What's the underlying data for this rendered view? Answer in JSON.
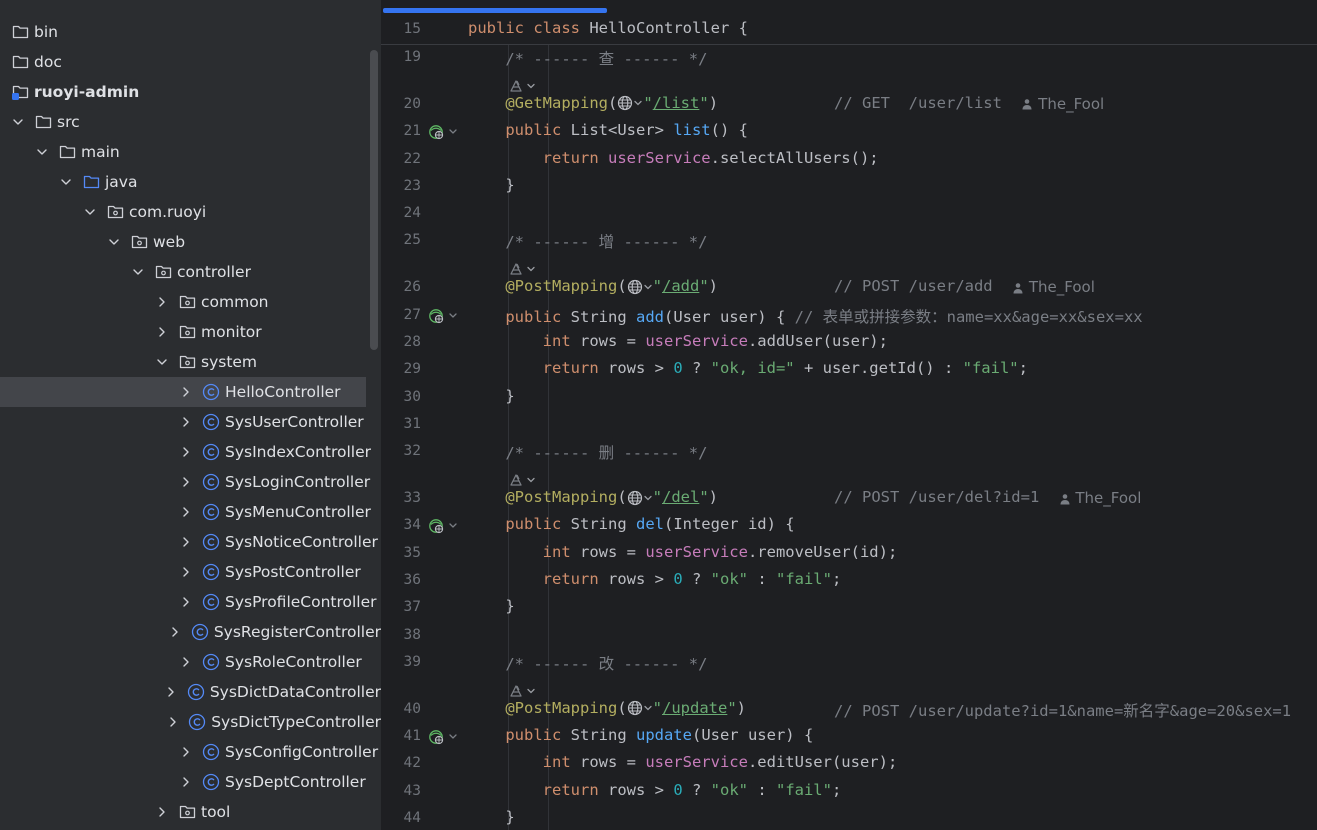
{
  "project_tree": {
    "items": [
      {
        "label": "bin",
        "indent": 0,
        "chevron": "none",
        "icon": "folder-icon",
        "bold": false,
        "selected": false
      },
      {
        "label": "doc",
        "indent": 0,
        "chevron": "none",
        "icon": "folder-icon",
        "bold": false,
        "selected": false
      },
      {
        "label": "ruoyi-admin",
        "indent": 0,
        "chevron": "none",
        "icon": "module-folder-icon",
        "bold": true,
        "selected": false
      },
      {
        "label": "src",
        "indent": 1,
        "chevron": "down",
        "icon": "folder-icon",
        "bold": false,
        "selected": false
      },
      {
        "label": "main",
        "indent": 2,
        "chevron": "down",
        "icon": "folder-icon",
        "bold": false,
        "selected": false
      },
      {
        "label": "java",
        "indent": 3,
        "chevron": "down",
        "icon": "source-folder-icon",
        "bold": false,
        "selected": false
      },
      {
        "label": "com.ruoyi",
        "indent": 4,
        "chevron": "down",
        "icon": "package-icon",
        "bold": false,
        "selected": false
      },
      {
        "label": "web",
        "indent": 5,
        "chevron": "down",
        "icon": "package-icon",
        "bold": false,
        "selected": false
      },
      {
        "label": "controller",
        "indent": 6,
        "chevron": "down",
        "icon": "package-icon",
        "bold": false,
        "selected": false
      },
      {
        "label": "common",
        "indent": 7,
        "chevron": "right",
        "icon": "package-icon",
        "bold": false,
        "selected": false
      },
      {
        "label": "monitor",
        "indent": 7,
        "chevron": "right",
        "icon": "package-icon",
        "bold": false,
        "selected": false
      },
      {
        "label": "system",
        "indent": 7,
        "chevron": "down",
        "icon": "package-icon",
        "bold": false,
        "selected": false
      },
      {
        "label": "HelloController",
        "indent": 8,
        "chevron": "right",
        "icon": "class-icon",
        "bold": false,
        "selected": true
      },
      {
        "label": "SysUserController",
        "indent": 8,
        "chevron": "right",
        "icon": "class-icon",
        "bold": false,
        "selected": false
      },
      {
        "label": "SysIndexController",
        "indent": 8,
        "chevron": "right",
        "icon": "class-icon",
        "bold": false,
        "selected": false
      },
      {
        "label": "SysLoginController",
        "indent": 8,
        "chevron": "right",
        "icon": "class-icon",
        "bold": false,
        "selected": false
      },
      {
        "label": "SysMenuController",
        "indent": 8,
        "chevron": "right",
        "icon": "class-icon",
        "bold": false,
        "selected": false
      },
      {
        "label": "SysNoticeController",
        "indent": 8,
        "chevron": "right",
        "icon": "class-icon",
        "bold": false,
        "selected": false
      },
      {
        "label": "SysPostController",
        "indent": 8,
        "chevron": "right",
        "icon": "class-icon",
        "bold": false,
        "selected": false
      },
      {
        "label": "SysProfileController",
        "indent": 8,
        "chevron": "right",
        "icon": "class-icon",
        "bold": false,
        "selected": false
      },
      {
        "label": "SysRegisterController",
        "indent": 8,
        "chevron": "right",
        "icon": "class-icon",
        "bold": false,
        "selected": false
      },
      {
        "label": "SysRoleController",
        "indent": 8,
        "chevron": "right",
        "icon": "class-icon",
        "bold": false,
        "selected": false
      },
      {
        "label": "SysDictDataController",
        "indent": 8,
        "chevron": "right",
        "icon": "class-icon",
        "bold": false,
        "selected": false
      },
      {
        "label": "SysDictTypeController",
        "indent": 8,
        "chevron": "right",
        "icon": "class-icon",
        "bold": false,
        "selected": false
      },
      {
        "label": "SysConfigController",
        "indent": 8,
        "chevron": "right",
        "icon": "class-icon",
        "bold": false,
        "selected": false
      },
      {
        "label": "SysDeptController",
        "indent": 8,
        "chevron": "right",
        "icon": "class-icon",
        "bold": false,
        "selected": false
      },
      {
        "label": "tool",
        "indent": 7,
        "chevron": "right",
        "icon": "package-icon",
        "bold": false,
        "selected": false
      }
    ]
  },
  "editor": {
    "colors": {
      "keyword": "#cf8e6d",
      "annotation": "#b3ae60",
      "string": "#6aab73",
      "function": "#56a8f5",
      "field": "#c77dbb",
      "number": "#2aacb8",
      "comment": "#7a7e85",
      "accent": "#3574f0"
    },
    "sticky_line": {
      "number": "15",
      "tokens": [
        {
          "t": "public class ",
          "c": "kw"
        },
        {
          "t": "HelloController {",
          "c": ""
        }
      ]
    },
    "lines": [
      {
        "type": "code",
        "number": "19",
        "tokens": [
          {
            "t": "    /* ------ 查 ------ */",
            "c": "cm"
          }
        ]
      },
      {
        "type": "hint",
        "icon": "web-endpoint-icon"
      },
      {
        "type": "code",
        "number": "20",
        "endpoint": {
          "path": "/list",
          "comment": "// GET  /user/list",
          "author": "The_Fool",
          "annotation": "@GetMapping"
        }
      },
      {
        "type": "code",
        "number": "21",
        "gutter": "bean-icon",
        "tokens": [
          {
            "t": "    ",
            "c": ""
          },
          {
            "t": "public ",
            "c": "kw"
          },
          {
            "t": "List<User> ",
            "c": ""
          },
          {
            "t": "list",
            "c": "fn"
          },
          {
            "t": "() {",
            "c": ""
          }
        ]
      },
      {
        "type": "code",
        "number": "22",
        "tokens": [
          {
            "t": "        ",
            "c": ""
          },
          {
            "t": "return ",
            "c": "kw"
          },
          {
            "t": "userService",
            "c": "fd"
          },
          {
            "t": ".selectAllUsers();",
            "c": ""
          }
        ]
      },
      {
        "type": "code",
        "number": "23",
        "tokens": [
          {
            "t": "    }",
            "c": ""
          }
        ]
      },
      {
        "type": "code",
        "number": "24",
        "tokens": []
      },
      {
        "type": "code",
        "number": "25",
        "tokens": [
          {
            "t": "    /* ------ 增 ------ */",
            "c": "cm"
          }
        ]
      },
      {
        "type": "hint",
        "icon": "web-endpoint-icon"
      },
      {
        "type": "code",
        "number": "26",
        "endpoint": {
          "path": "/add",
          "comment": "// POST /user/add",
          "author": "The_Fool",
          "annotation": "@PostMapping"
        }
      },
      {
        "type": "code",
        "number": "27",
        "gutter": "bean-icon",
        "tokens": [
          {
            "t": "    ",
            "c": ""
          },
          {
            "t": "public ",
            "c": "kw"
          },
          {
            "t": "String ",
            "c": ""
          },
          {
            "t": "add",
            "c": "fn"
          },
          {
            "t": "(User user) { ",
            "c": ""
          },
          {
            "t": "// 表单或拼接参数：name=xx&age=xx&sex=xx",
            "c": "cm"
          }
        ]
      },
      {
        "type": "code",
        "number": "28",
        "tokens": [
          {
            "t": "        ",
            "c": ""
          },
          {
            "t": "int ",
            "c": "kw"
          },
          {
            "t": "rows = ",
            "c": ""
          },
          {
            "t": "userService",
            "c": "fd"
          },
          {
            "t": ".addUser(user);",
            "c": ""
          }
        ]
      },
      {
        "type": "code",
        "number": "29",
        "tokens": [
          {
            "t": "        ",
            "c": ""
          },
          {
            "t": "return ",
            "c": "kw"
          },
          {
            "t": "rows > ",
            "c": ""
          },
          {
            "t": "0",
            "c": "nm"
          },
          {
            "t": " ? ",
            "c": ""
          },
          {
            "t": "\"ok, id=\"",
            "c": "st"
          },
          {
            "t": " + user.getId() : ",
            "c": ""
          },
          {
            "t": "\"fail\"",
            "c": "st"
          },
          {
            "t": ";",
            "c": ""
          }
        ]
      },
      {
        "type": "code",
        "number": "30",
        "tokens": [
          {
            "t": "    }",
            "c": ""
          }
        ]
      },
      {
        "type": "code",
        "number": "31",
        "tokens": []
      },
      {
        "type": "code",
        "number": "32",
        "tokens": [
          {
            "t": "    /* ------ 删 ------ */",
            "c": "cm"
          }
        ]
      },
      {
        "type": "hint",
        "icon": "web-endpoint-icon"
      },
      {
        "type": "code",
        "number": "33",
        "endpoint": {
          "path": "/del",
          "comment": "// POST /user/del?id=1",
          "author": "The_Fool",
          "annotation": "@PostMapping"
        }
      },
      {
        "type": "code",
        "number": "34",
        "gutter": "bean-icon",
        "tokens": [
          {
            "t": "    ",
            "c": ""
          },
          {
            "t": "public ",
            "c": "kw"
          },
          {
            "t": "String ",
            "c": ""
          },
          {
            "t": "del",
            "c": "fn"
          },
          {
            "t": "(Integer id) {",
            "c": ""
          }
        ]
      },
      {
        "type": "code",
        "number": "35",
        "tokens": [
          {
            "t": "        ",
            "c": ""
          },
          {
            "t": "int ",
            "c": "kw"
          },
          {
            "t": "rows = ",
            "c": ""
          },
          {
            "t": "userService",
            "c": "fd"
          },
          {
            "t": ".removeUser(id);",
            "c": ""
          }
        ]
      },
      {
        "type": "code",
        "number": "36",
        "tokens": [
          {
            "t": "        ",
            "c": ""
          },
          {
            "t": "return ",
            "c": "kw"
          },
          {
            "t": "rows > ",
            "c": ""
          },
          {
            "t": "0",
            "c": "nm"
          },
          {
            "t": " ? ",
            "c": ""
          },
          {
            "t": "\"ok\"",
            "c": "st"
          },
          {
            "t": " : ",
            "c": ""
          },
          {
            "t": "\"fail\"",
            "c": "st"
          },
          {
            "t": ";",
            "c": ""
          }
        ]
      },
      {
        "type": "code",
        "number": "37",
        "tokens": [
          {
            "t": "    }",
            "c": ""
          }
        ]
      },
      {
        "type": "code",
        "number": "38",
        "tokens": []
      },
      {
        "type": "code",
        "number": "39",
        "tokens": [
          {
            "t": "    /* ------ 改 ------ */",
            "c": "cm"
          }
        ]
      },
      {
        "type": "hint",
        "icon": "web-endpoint-icon"
      },
      {
        "type": "code",
        "number": "40",
        "endpoint": {
          "path": "/update",
          "comment": "// POST /user/update?id=1&name=新名字&age=20&sex=1",
          "author": "",
          "annotation": "@PostMapping"
        }
      },
      {
        "type": "code",
        "number": "41",
        "gutter": "bean-icon",
        "tokens": [
          {
            "t": "    ",
            "c": ""
          },
          {
            "t": "public ",
            "c": "kw"
          },
          {
            "t": "String ",
            "c": ""
          },
          {
            "t": "update",
            "c": "fn"
          },
          {
            "t": "(User user) {",
            "c": ""
          }
        ]
      },
      {
        "type": "code",
        "number": "42",
        "tokens": [
          {
            "t": "        ",
            "c": ""
          },
          {
            "t": "int ",
            "c": "kw"
          },
          {
            "t": "rows = ",
            "c": ""
          },
          {
            "t": "userService",
            "c": "fd"
          },
          {
            "t": ".editUser(user);",
            "c": ""
          }
        ]
      },
      {
        "type": "code",
        "number": "43",
        "tokens": [
          {
            "t": "        ",
            "c": ""
          },
          {
            "t": "return ",
            "c": "kw"
          },
          {
            "t": "rows > ",
            "c": ""
          },
          {
            "t": "0",
            "c": "nm"
          },
          {
            "t": " ? ",
            "c": ""
          },
          {
            "t": "\"ok\"",
            "c": "st"
          },
          {
            "t": " : ",
            "c": ""
          },
          {
            "t": "\"fail\"",
            "c": "st"
          },
          {
            "t": ";",
            "c": ""
          }
        ]
      },
      {
        "type": "code",
        "number": "44",
        "tokens": [
          {
            "t": "    }",
            "c": ""
          }
        ]
      }
    ]
  }
}
